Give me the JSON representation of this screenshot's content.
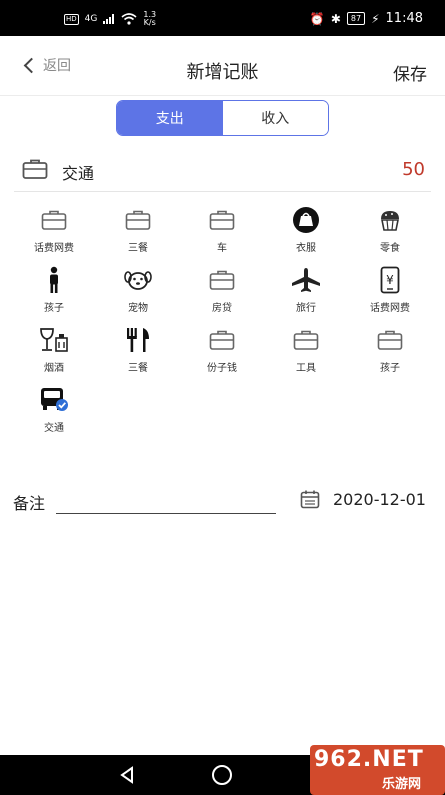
{
  "status_bar": {
    "hd": "HD",
    "signal": "4G",
    "speed_value": "1.3",
    "speed_unit": "K/s",
    "battery": "87",
    "time": "11:48"
  },
  "header": {
    "back_label": "返回",
    "title": "新增记账",
    "save_label": "保存"
  },
  "tabs": [
    {
      "label": "支出",
      "active": true
    },
    {
      "label": "收入",
      "active": false
    }
  ],
  "selected": {
    "icon": "briefcase-icon",
    "name": "交通",
    "amount": "50"
  },
  "categories": [
    {
      "label": "话费网费",
      "icon": "briefcase-icon"
    },
    {
      "label": "三餐",
      "icon": "briefcase-icon"
    },
    {
      "label": "车",
      "icon": "briefcase-icon"
    },
    {
      "label": "衣服",
      "icon": "bag-icon"
    },
    {
      "label": "零食",
      "icon": "cupcake-icon"
    },
    {
      "label": "孩子",
      "icon": "child-icon"
    },
    {
      "label": "宠物",
      "icon": "pet-icon"
    },
    {
      "label": "房贷",
      "icon": "briefcase-icon"
    },
    {
      "label": "旅行",
      "icon": "airplane-icon"
    },
    {
      "label": "话费网费",
      "icon": "phone-yuan-icon"
    },
    {
      "label": "烟酒",
      "icon": "wine-icon"
    },
    {
      "label": "三餐",
      "icon": "fork-knife-icon"
    },
    {
      "label": "份子钱",
      "icon": "briefcase-icon"
    },
    {
      "label": "工具",
      "icon": "briefcase-icon"
    },
    {
      "label": "孩子",
      "icon": "briefcase-icon"
    },
    {
      "label": "交通",
      "icon": "bus-icon",
      "selected": true
    }
  ],
  "note": {
    "label": "备注",
    "value": "",
    "placeholder": ""
  },
  "date": {
    "icon": "calendar-icon",
    "value": "2020-12-01"
  },
  "watermark": {
    "top": "962.NET",
    "bottom": "乐游网"
  },
  "colors": {
    "accent": "#5d74e6",
    "amount": "#c0392b"
  }
}
